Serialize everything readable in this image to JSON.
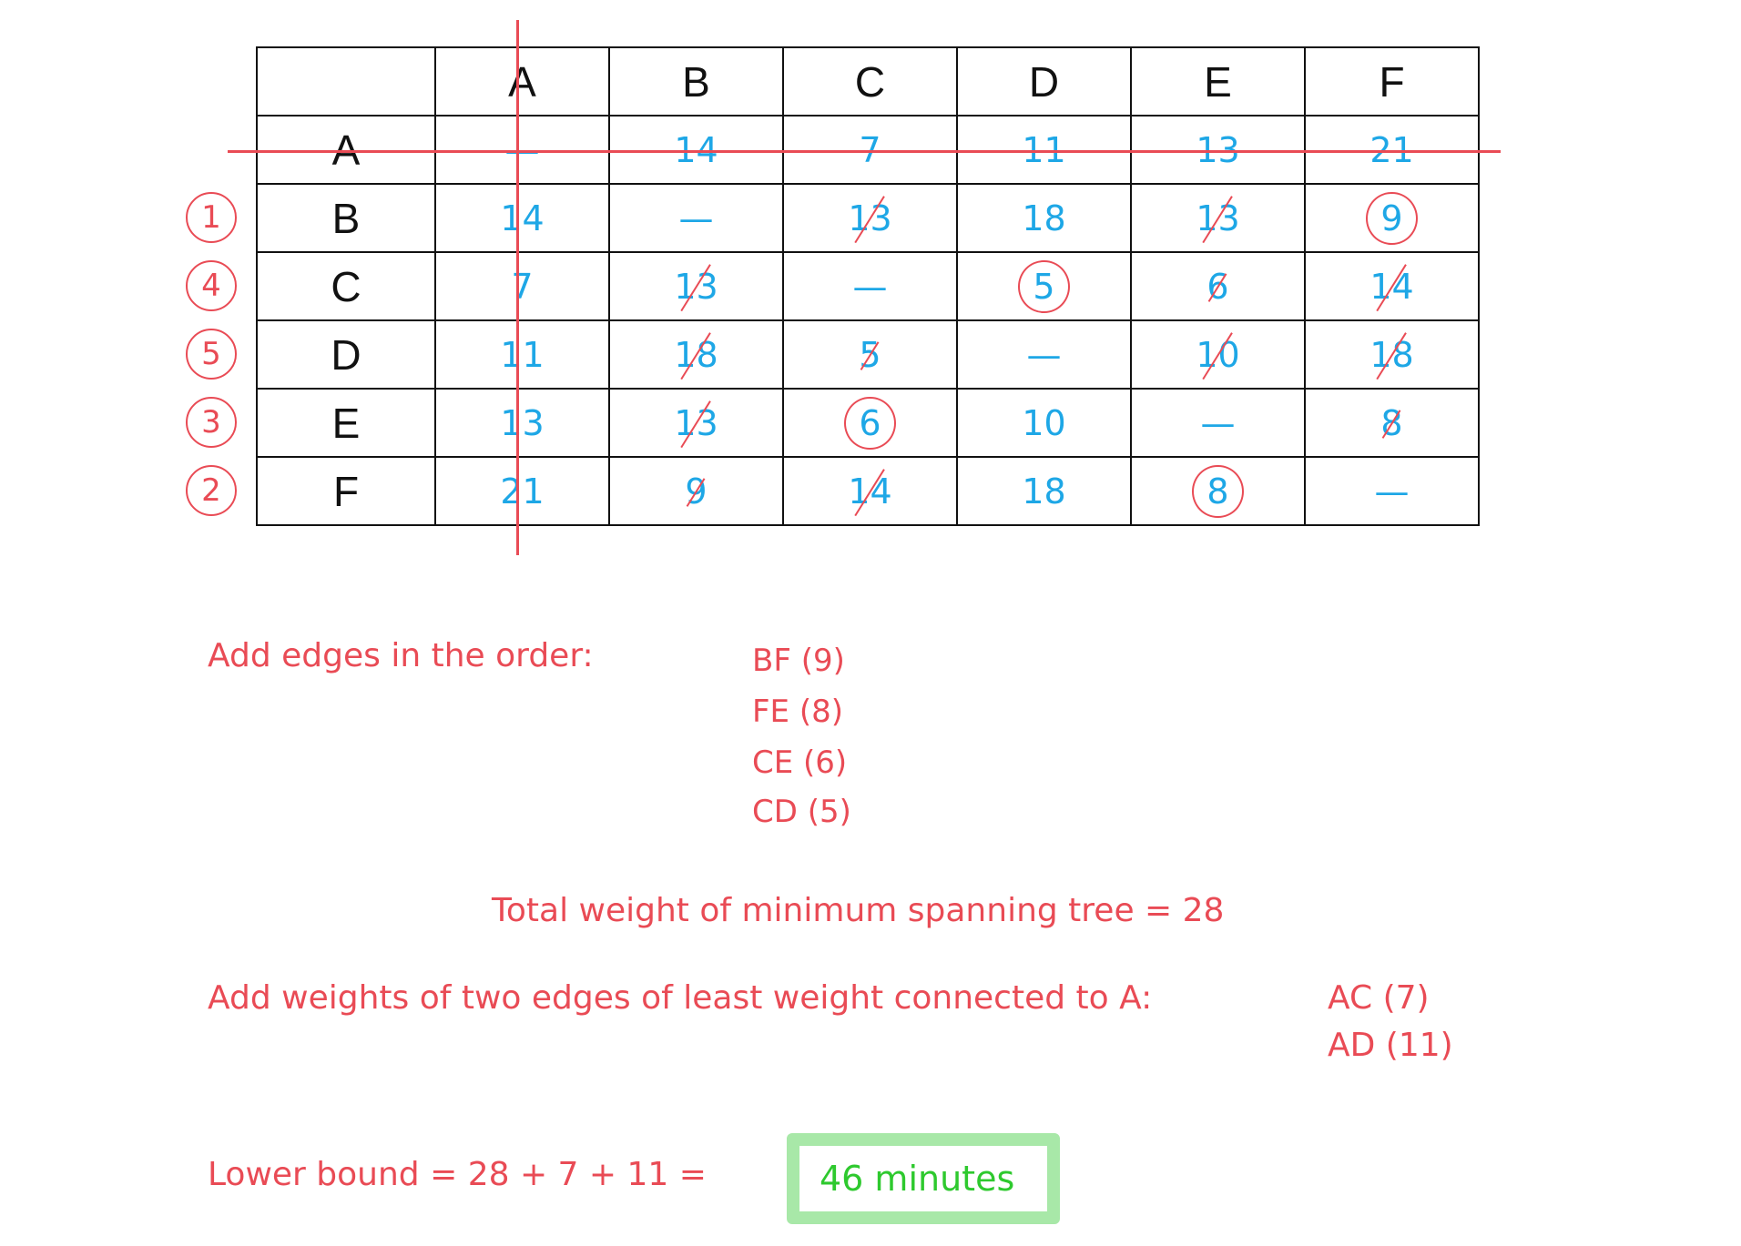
{
  "table": {
    "column_headers": [
      "",
      "A",
      "B",
      "C",
      "D",
      "E",
      "F"
    ],
    "rows": [
      {
        "label": "A",
        "order": null,
        "cells": [
          {
            "v": "—",
            "s": "plain"
          },
          {
            "v": "14",
            "s": "plain"
          },
          {
            "v": "7",
            "s": "plain"
          },
          {
            "v": "11",
            "s": "plain"
          },
          {
            "v": "13",
            "s": "plain"
          },
          {
            "v": "21",
            "s": "plain"
          }
        ]
      },
      {
        "label": "B",
        "order": "1",
        "cells": [
          {
            "v": "14",
            "s": "plain"
          },
          {
            "v": "—",
            "s": "plain"
          },
          {
            "v": "13",
            "s": "crossed"
          },
          {
            "v": "18",
            "s": "plain"
          },
          {
            "v": "13",
            "s": "crossed"
          },
          {
            "v": "9",
            "s": "circled"
          }
        ]
      },
      {
        "label": "C",
        "order": "4",
        "cells": [
          {
            "v": "7",
            "s": "plain"
          },
          {
            "v": "13",
            "s": "crossed"
          },
          {
            "v": "—",
            "s": "plain"
          },
          {
            "v": "5",
            "s": "circled"
          },
          {
            "v": "6",
            "s": "crossed"
          },
          {
            "v": "14",
            "s": "crossed"
          }
        ]
      },
      {
        "label": "D",
        "order": "5",
        "cells": [
          {
            "v": "11",
            "s": "plain"
          },
          {
            "v": "18",
            "s": "crossed"
          },
          {
            "v": "5",
            "s": "crossed"
          },
          {
            "v": "—",
            "s": "plain"
          },
          {
            "v": "10",
            "s": "crossed"
          },
          {
            "v": "18",
            "s": "crossed"
          }
        ]
      },
      {
        "label": "E",
        "order": "3",
        "cells": [
          {
            "v": "13",
            "s": "plain"
          },
          {
            "v": "13",
            "s": "crossed"
          },
          {
            "v": "6",
            "s": "circled"
          },
          {
            "v": "10",
            "s": "plain"
          },
          {
            "v": "—",
            "s": "plain"
          },
          {
            "v": "8",
            "s": "crossed"
          }
        ]
      },
      {
        "label": "F",
        "order": "2",
        "cells": [
          {
            "v": "21",
            "s": "plain"
          },
          {
            "v": "9",
            "s": "crossed"
          },
          {
            "v": "14",
            "s": "crossed"
          },
          {
            "v": "18",
            "s": "plain"
          },
          {
            "v": "8",
            "s": "circled"
          },
          {
            "v": "—",
            "s": "plain"
          }
        ]
      }
    ],
    "deleted_vertex": "A"
  },
  "working": {
    "order_intro": "Add edges in the order:",
    "edges": [
      "BF  (9)",
      "FE  (8)",
      "CE  (6)",
      "CD  (5)"
    ],
    "mst_total": "Total weight of minimum spanning tree = 28",
    "add_weights": "Add weights of two edges of least weight connected to A:",
    "least_edges": [
      "AC  (7)",
      "AD  (11)"
    ],
    "lower_bound": "Lower bound = 28 + 7 + 11 =",
    "answer": "46 minutes"
  },
  "colors": {
    "ink_red": "#e94b55",
    "ink_blue": "#1ea7e6",
    "answer_green": "#2ec92e",
    "box_green": "#a8e8a8"
  }
}
